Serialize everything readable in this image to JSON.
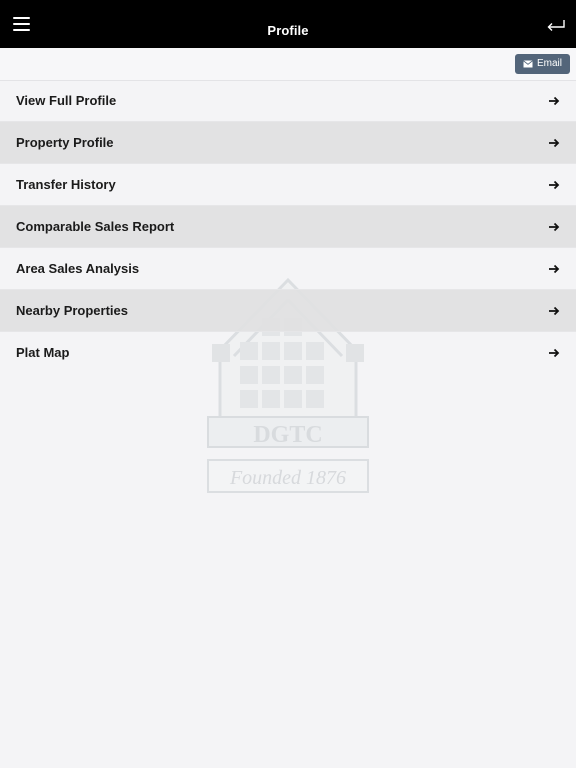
{
  "header": {
    "title": "Profile"
  },
  "toolbar": {
    "email_label": "Email"
  },
  "menu": [
    {
      "label": "View Full Profile"
    },
    {
      "label": "Property Profile"
    },
    {
      "label": "Transfer History"
    },
    {
      "label": "Comparable Sales Report"
    },
    {
      "label": "Area Sales Analysis"
    },
    {
      "label": "Nearby Properties"
    },
    {
      "label": "Plat Map"
    }
  ],
  "watermark": {
    "brand": "DGTC",
    "tagline": "Founded 1876"
  },
  "colors": {
    "header_bg": "#000000",
    "email_button": "#53657a",
    "row_alt": "#e0e0e2",
    "page_bg": "#f4f4f6"
  },
  "icons": {
    "menu": "hamburger-icon",
    "back": "return-arrow-icon",
    "email": "envelope-icon",
    "row_arrow": "arrow-right-icon"
  }
}
